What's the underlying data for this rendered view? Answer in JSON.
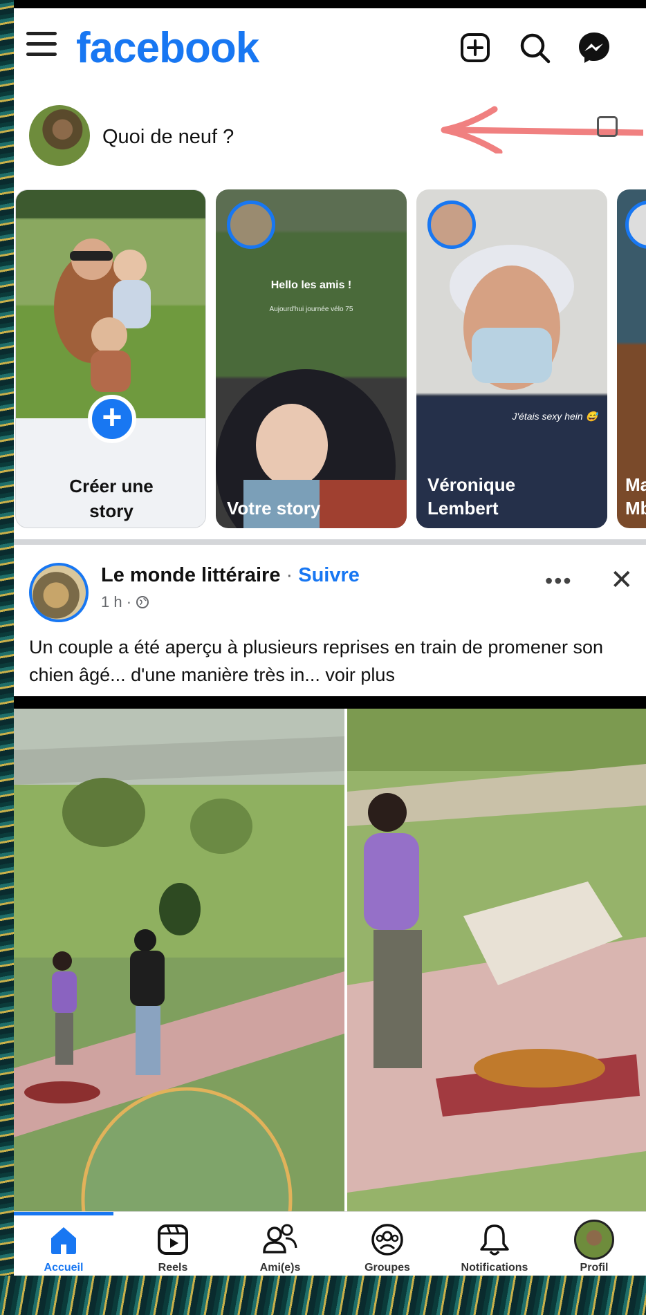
{
  "header": {
    "logo": "facebook",
    "icons": [
      "create-post-icon",
      "search-icon",
      "messenger-icon"
    ]
  },
  "composer": {
    "placeholder": "Quoi de neuf ?"
  },
  "stories": {
    "create_label_line1": "Créer une",
    "create_label_line2": "story",
    "items": [
      {
        "name": "Votre story",
        "overlay_title": "Hello les amis !",
        "overlay_sub": "Aujourd'hui journée vélo 75"
      },
      {
        "name_line1": "Véronique",
        "name_line2": "Lembert",
        "caption": "J'étais sexy hein 😅"
      },
      {
        "name_line1": "Ma",
        "name_line2": "Mb"
      }
    ]
  },
  "post": {
    "page_name": "Le monde littéraire",
    "separator": " · ",
    "follow": "Suivre",
    "time": "1 h · ",
    "globe": "🌐",
    "more": "•••",
    "close": "✕",
    "text": "Un couple a été aperçu à plusieurs reprises en train de promener son chien âgé... d'une manière très in... voir plus"
  },
  "nav": {
    "items": [
      {
        "label": "Accueil",
        "icon": "home-icon",
        "active": true
      },
      {
        "label": "Reels",
        "icon": "reels-icon"
      },
      {
        "label": "Ami(e)s",
        "icon": "friends-icon"
      },
      {
        "label": "Groupes",
        "icon": "groups-icon"
      },
      {
        "label": "Notifications",
        "icon": "bell-icon"
      },
      {
        "label": "Profil",
        "icon": "profile-avatar"
      }
    ]
  },
  "colors": {
    "brand": "#1877f2",
    "arrow": "#f08080"
  }
}
